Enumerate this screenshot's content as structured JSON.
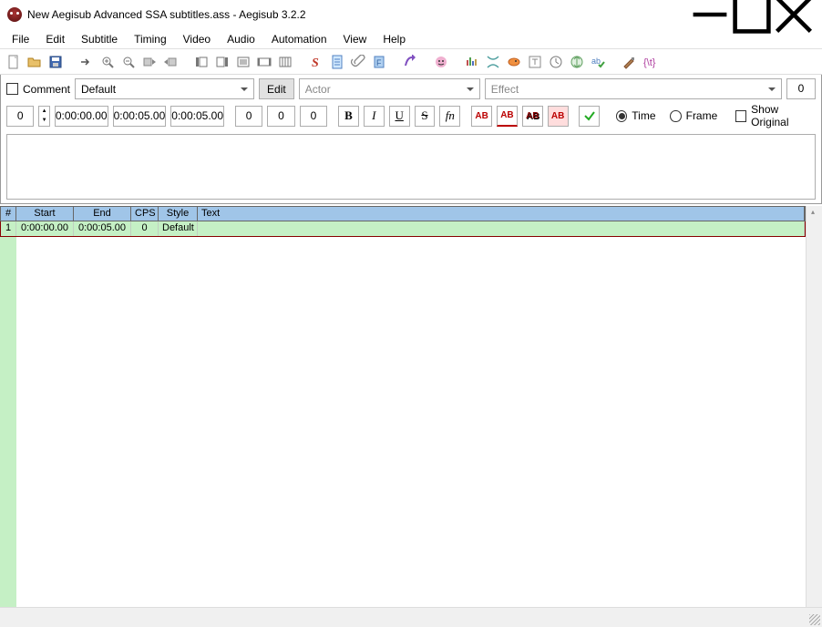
{
  "title": "New Aegisub Advanced SSA subtitles.ass - Aegisub 3.2.2",
  "menu": [
    "File",
    "Edit",
    "Subtitle",
    "Timing",
    "Video",
    "Audio",
    "Automation",
    "View",
    "Help"
  ],
  "edit": {
    "comment_label": "Comment",
    "style": "Default",
    "edit_btn": "Edit",
    "actor_placeholder": "Actor",
    "effect_placeholder": "Effect",
    "layer": "0",
    "start": "0:00:00.00",
    "end": "0:00:05.00",
    "duration": "0:00:05.00",
    "margin_l": "0",
    "margin_r": "0",
    "margin_v": "0",
    "char_count": "0",
    "fmt": {
      "b": "B",
      "i": "I",
      "u": "U",
      "s": "S",
      "fn": "fn"
    },
    "ab1": "AB",
    "ab2": "AB",
    "ab3": "AB",
    "ab4": "AB",
    "time_label": "Time",
    "frame_label": "Frame",
    "show_original": "Show Original"
  },
  "grid": {
    "headers": [
      "#",
      "Start",
      "End",
      "CPS",
      "Style",
      "Text"
    ],
    "rows": [
      {
        "n": "1",
        "start": "0:00:00.00",
        "end": "0:00:05.00",
        "cps": "0",
        "style": "Default",
        "text": ""
      }
    ]
  }
}
